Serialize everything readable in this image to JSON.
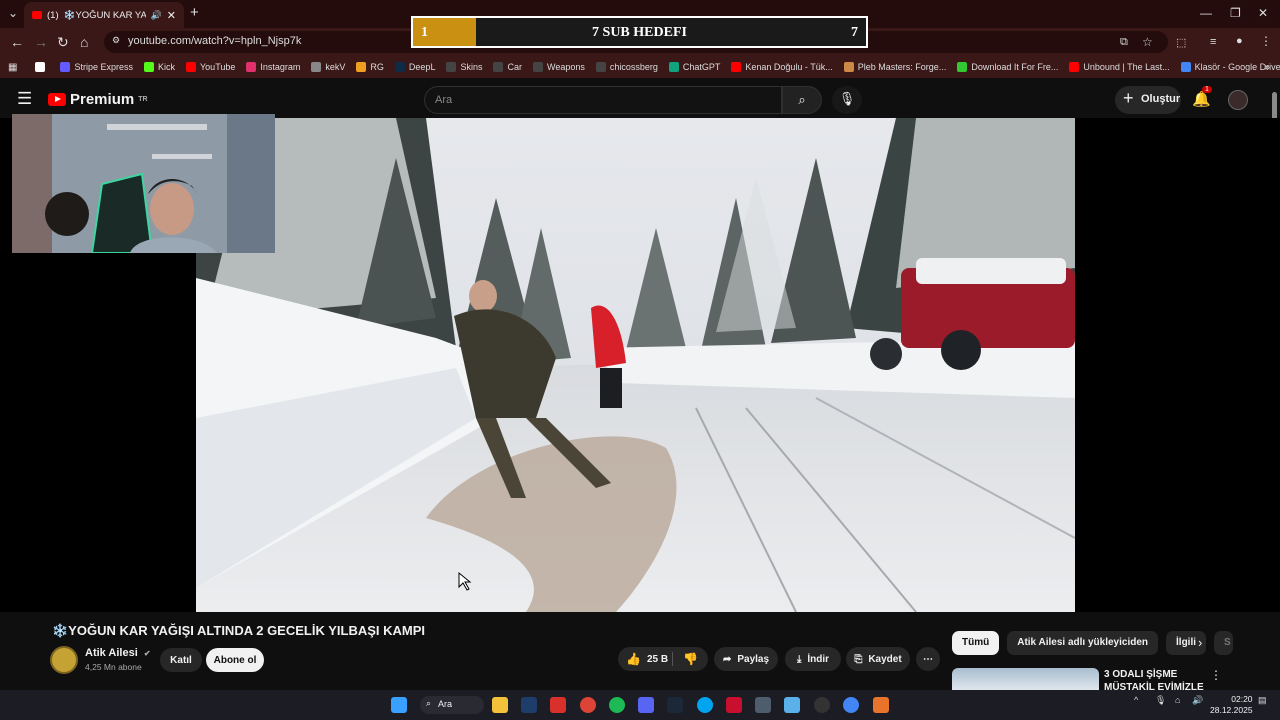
{
  "browser": {
    "tab": {
      "badge": "(1)",
      "title": "❄️YOĞUN KAR YAĞIŞI A"
    },
    "url": "youtube.com/watch?v=hpln_Njsp7k",
    "bookmarks": [
      {
        "label": "",
        "color": "#ffffff"
      },
      {
        "label": "Stripe Express",
        "color": "#635bff"
      },
      {
        "label": "Kick",
        "color": "#53fc18"
      },
      {
        "label": "YouTube",
        "color": "#ff0000"
      },
      {
        "label": "Instagram",
        "color": "#e1306c"
      },
      {
        "label": "kekV",
        "color": "#888888"
      },
      {
        "label": "RG",
        "color": "#f0a020"
      },
      {
        "label": "DeepL",
        "color": "#0f2b46"
      },
      {
        "label": "Skins",
        "color": "#444444"
      },
      {
        "label": "Car",
        "color": "#444444"
      },
      {
        "label": "Weapons",
        "color": "#444444"
      },
      {
        "label": "chicossberg",
        "color": "#444444"
      },
      {
        "label": "ChatGPT",
        "color": "#10a37f"
      },
      {
        "label": "Kenan Doğulu - Tük...",
        "color": "#ff0000"
      },
      {
        "label": "Pleb Masters: Forge...",
        "color": "#cc8844"
      },
      {
        "label": "Download It For Fre...",
        "color": "#32c832"
      },
      {
        "label": "Unbound | The Last...",
        "color": "#ff0000"
      },
      {
        "label": "Klasör - Google Drive",
        "color": "#4285f4"
      }
    ]
  },
  "overlay": {
    "sub_goal_current": "1",
    "sub_goal_label": "7 SUB HEDEFI",
    "sub_goal_target": "7",
    "sub_goal_progress": 0.14
  },
  "youtube": {
    "logo": "Premium",
    "logo_region": "TR",
    "search_placeholder": "Ara",
    "create_label": "Oluştur",
    "notif_count": "1"
  },
  "video": {
    "title": "❄️YOĞUN KAR YAĞIŞI ALTINDA 2 GECELİK YILBAŞI KAMPI",
    "channel": "Atik Ailesi",
    "subscribers": "4,25 Mn abone",
    "join_label": "Katıl",
    "subscribe_label": "Abone ol",
    "likes": "25 B",
    "share_label": "Paylaş",
    "download_label": "İndir",
    "save_label": "Kaydet"
  },
  "sidebar": {
    "chips": [
      "Tümü",
      "Atik Ailesi adlı yükleyiciden",
      "İlgili",
      "S"
    ],
    "rec_title": "3 ODALI ŞİŞME MÜSTAKİL EVİMİZLE"
  },
  "taskbar": {
    "search_label": "Ara",
    "time": "02:20",
    "date": "28.12.2025"
  }
}
